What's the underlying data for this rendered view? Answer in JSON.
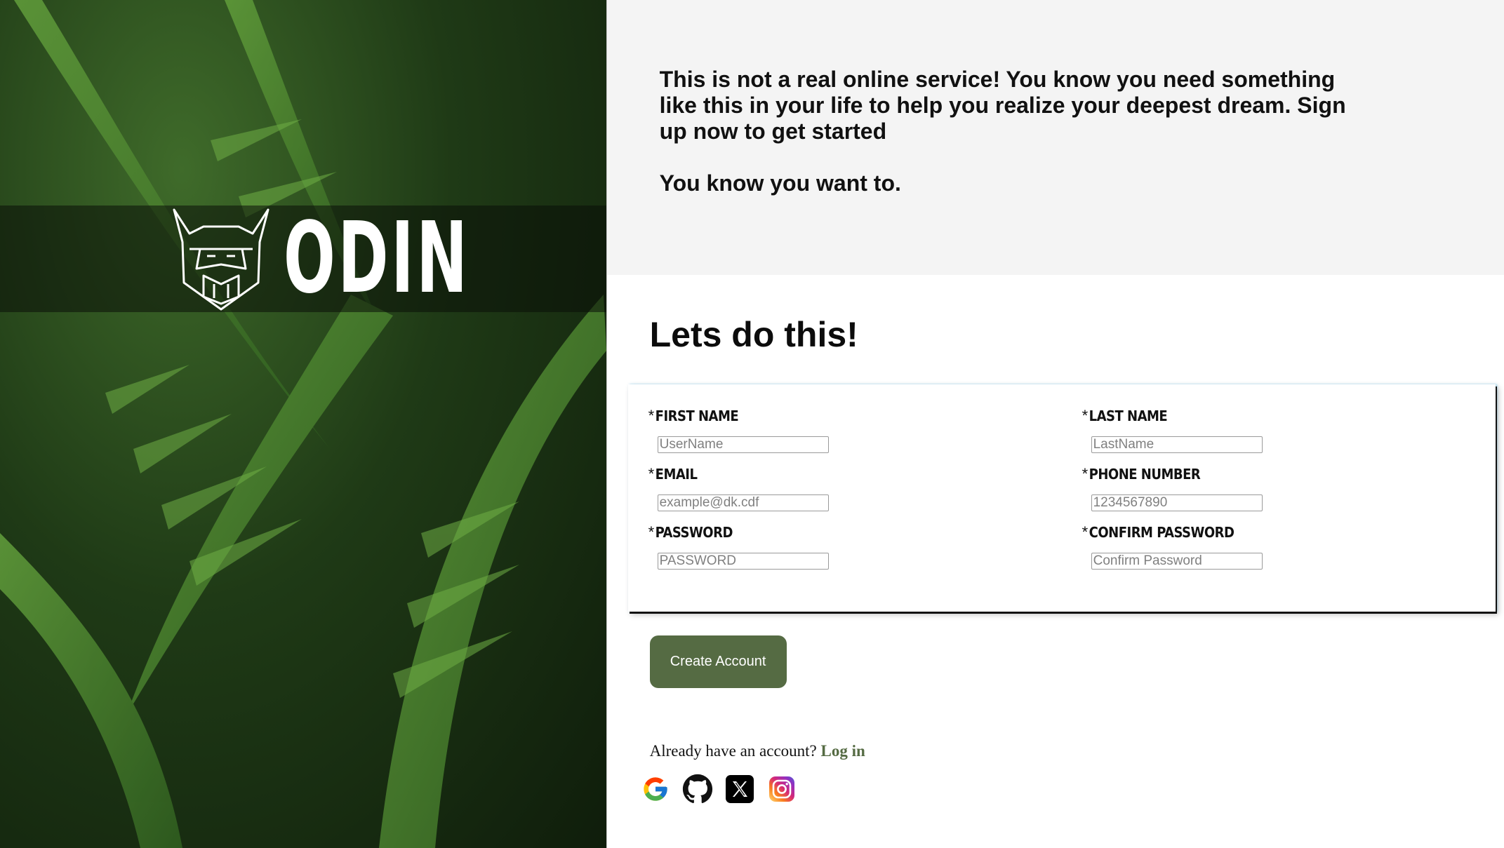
{
  "brand": {
    "name": "ODIN"
  },
  "intro": {
    "text": "This is not a real online service! You know you need something like this in your life to help you realize your deepest dream. Sign up now to get started",
    "tagline": "You know you want to."
  },
  "form": {
    "heading": "Lets do this!",
    "required_marker": "*",
    "fields": [
      {
        "label": "FIRST NAME",
        "placeholder": "UserName"
      },
      {
        "label": "LAST NAME",
        "placeholder": "LastName"
      },
      {
        "label": "EMAIL",
        "placeholder": "example@dk.cdf"
      },
      {
        "label": "PHONE NUMBER",
        "placeholder": "1234567890"
      },
      {
        "label": "PASSWORD",
        "placeholder": "PASSWORD"
      },
      {
        "label": "CONFIRM PASSWORD",
        "placeholder": "Confirm Password"
      }
    ],
    "submit_label": "Create Account"
  },
  "login": {
    "prompt": "Already have an account?",
    "link_text": "Log in"
  },
  "socials": [
    {
      "icon": "google-icon"
    },
    {
      "icon": "github-icon"
    },
    {
      "icon": "x-icon"
    },
    {
      "icon": "instagram-icon"
    }
  ],
  "colors": {
    "accent": "#556b43",
    "intro_bg": "#f4f4f4"
  }
}
